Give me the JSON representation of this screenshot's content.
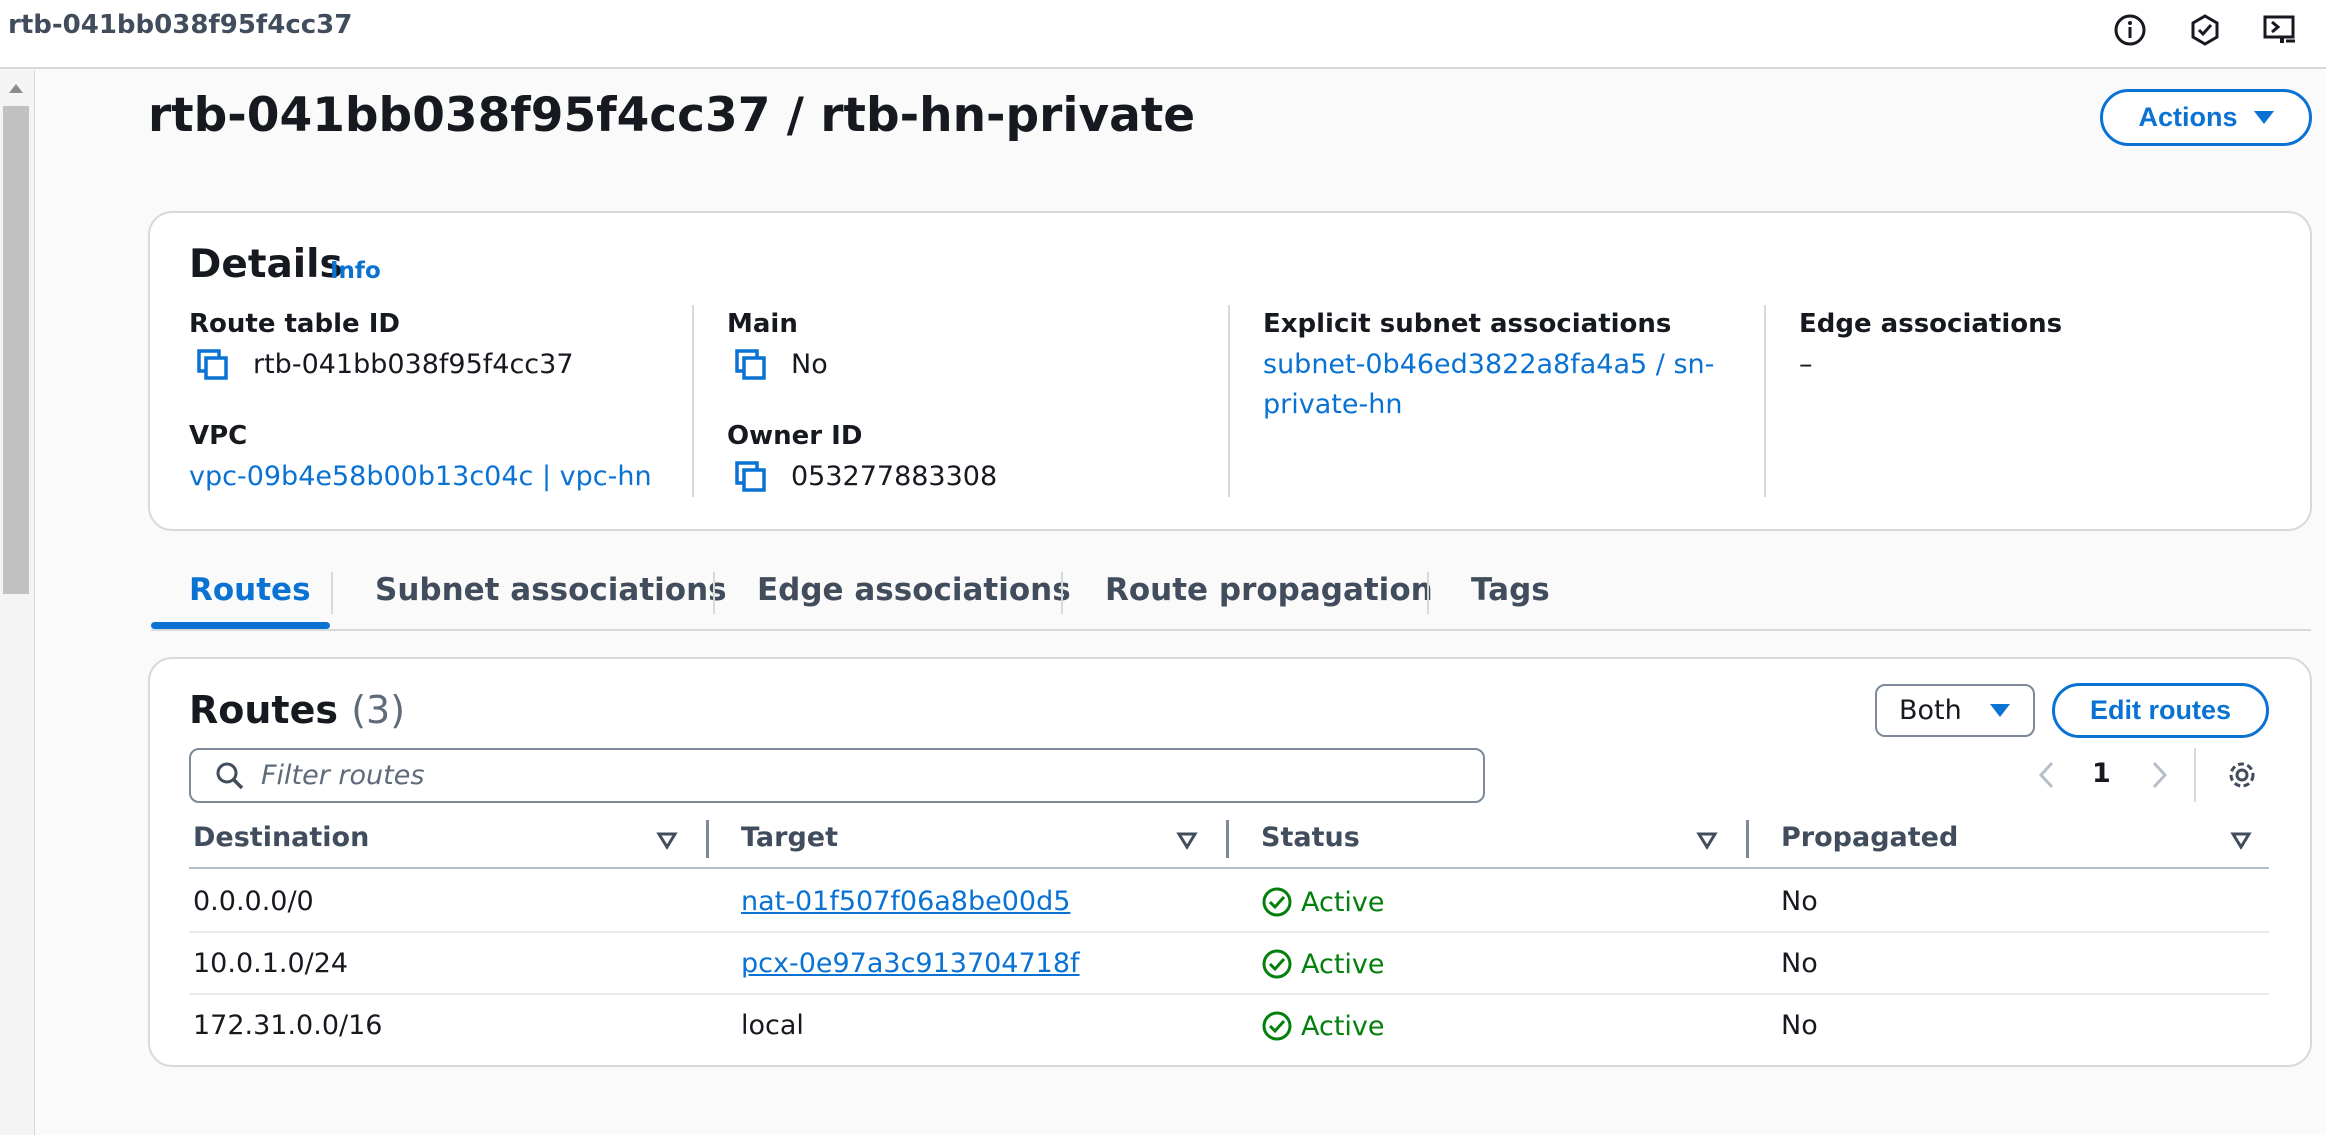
{
  "header": {
    "title": "rtb-041bb038f95f4cc37"
  },
  "page": {
    "title": "rtb-041bb038f95f4cc37 / rtb-hn-private",
    "actions_label": "Actions"
  },
  "details": {
    "heading": "Details",
    "info_label": "Info",
    "route_table_id_label": "Route table ID",
    "route_table_id": "rtb-041bb038f95f4cc37",
    "vpc_label": "VPC",
    "vpc": "vpc-09b4e58b00b13c04c | vpc-hn",
    "main_label": "Main",
    "main": "No",
    "owner_id_label": "Owner ID",
    "owner_id": "053277883308",
    "explicit_label": "Explicit subnet associations",
    "explicit_line1": "subnet-0b46ed3822a8fa4a5 / sn-",
    "explicit_line2": "private-hn",
    "edge_label": "Edge associations",
    "edge_value": "–"
  },
  "tabs": [
    {
      "label": "Routes",
      "active": true
    },
    {
      "label": "Subnet associations",
      "active": false
    },
    {
      "label": "Edge associations",
      "active": false
    },
    {
      "label": "Route propagation",
      "active": false
    },
    {
      "label": "Tags",
      "active": false
    }
  ],
  "routes": {
    "heading": "Routes",
    "count": "(3)",
    "filter_selected": "Both",
    "edit_label": "Edit routes",
    "filter_placeholder": "Filter routes",
    "page": "1",
    "columns": [
      "Destination",
      "Target",
      "Status",
      "Propagated"
    ],
    "rows": [
      {
        "destination": "0.0.0.0/0",
        "target": "nat-01f507f06a8be00d5",
        "target_link": true,
        "status": "Active",
        "propagated": "No"
      },
      {
        "destination": "10.0.1.0/24",
        "target": "pcx-0e97a3c913704718f",
        "target_link": true,
        "status": "Active",
        "propagated": "No"
      },
      {
        "destination": "172.31.0.0/16",
        "target": "local",
        "target_link": false,
        "status": "Active",
        "propagated": "No"
      }
    ]
  },
  "colors": {
    "accent": "#0972d3",
    "success": "#037f0c",
    "text": "#16191f",
    "muted": "#5f6b7a"
  },
  "icons": [
    "info-icon",
    "feedback-icon",
    "screen-share-icon",
    "copy-icon",
    "search-icon",
    "chevron-left-icon",
    "chevron-right-icon",
    "gear-icon",
    "sort-icon",
    "status-ok-icon"
  ]
}
